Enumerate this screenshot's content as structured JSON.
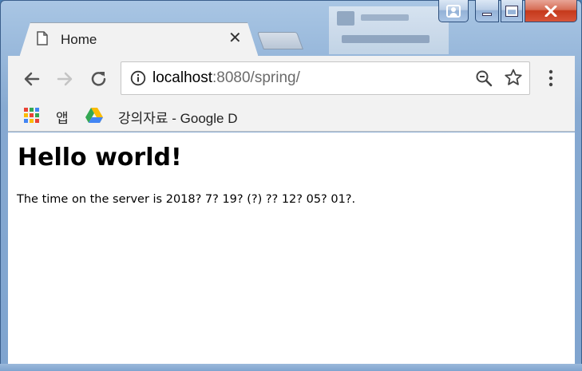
{
  "browser": {
    "tab": {
      "title": "Home",
      "close_glyph": "✕"
    },
    "address_bar": {
      "host": "localhost",
      "rest": ":8080/spring/"
    },
    "bookmarks": [
      {
        "label": "앱",
        "icon": "apps-icon"
      },
      {
        "label": "강의자료 - Google D",
        "icon": "google-drive-icon"
      }
    ],
    "icons": [
      "back-arrow-icon",
      "forward-arrow-icon",
      "reload-icon",
      "info-icon",
      "zoom-out-icon",
      "star-icon",
      "menu-icon"
    ],
    "accent_colors": {
      "close_button": "#c5391b",
      "title_bar": "#86a9d1"
    }
  },
  "page": {
    "heading": "Hello world!",
    "body": "The time on the server is 2018? 7? 19? (?) ?? 12? 05? 01?."
  }
}
